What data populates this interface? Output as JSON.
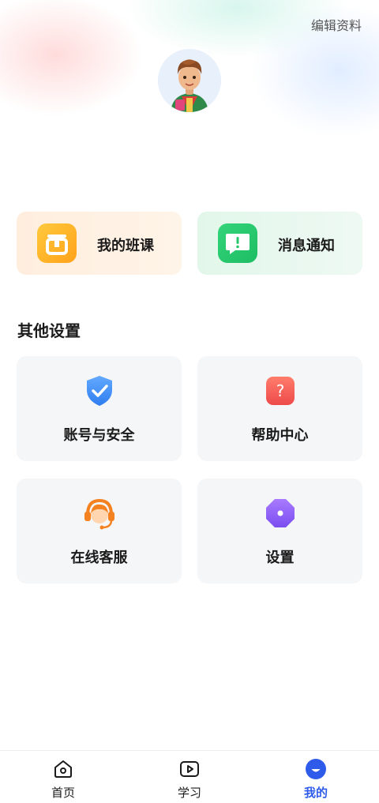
{
  "header": {
    "edit_profile": "编辑资料"
  },
  "quick_cards": [
    {
      "label": "我的班课",
      "icon": "class-icon"
    },
    {
      "label": "消息通知",
      "icon": "message-icon"
    }
  ],
  "section": {
    "title": "其他设置"
  },
  "settings": [
    {
      "label": "账号与安全",
      "icon": "shield-check-icon"
    },
    {
      "label": "帮助中心",
      "icon": "help-icon"
    },
    {
      "label": "在线客服",
      "icon": "headset-icon"
    },
    {
      "label": "设置",
      "icon": "settings-icon"
    }
  ],
  "tabs": [
    {
      "label": "首页",
      "icon": "home-icon"
    },
    {
      "label": "学习",
      "icon": "play-icon"
    },
    {
      "label": "我的",
      "icon": "profile-icon",
      "active": true
    }
  ],
  "colors": {
    "accent": "#2f5bea",
    "class_icon": "#ffb02e",
    "message_icon": "#27c86c",
    "help_icon": "#f25a57",
    "settings_icon": "#8b5cf6",
    "service_icon": "#f58220"
  }
}
